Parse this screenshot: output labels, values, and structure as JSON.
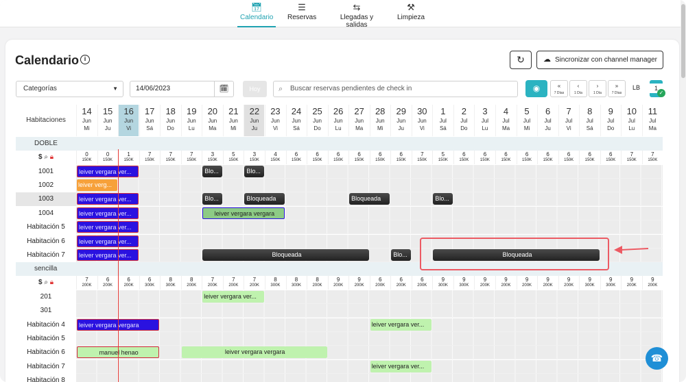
{
  "nav": [
    {
      "label": "Calendario",
      "icon": "calendar-icon",
      "active": true
    },
    {
      "label": "Reservas",
      "icon": "list-icon",
      "active": false
    },
    {
      "label": "Llegadas y salidas",
      "icon": "arrows-icon",
      "active": false
    },
    {
      "label": "Limpieza",
      "icon": "broom-icon",
      "active": false
    }
  ],
  "page": {
    "title": "Calendario",
    "sync_label": "Sincronizar con channel manager"
  },
  "filters": {
    "category_value": "Categorías",
    "date_value": "14/06/2023",
    "today_label": "Hoy",
    "search_placeholder": "Buscar reservas pendientes de check in",
    "nav_buttons": [
      {
        "sym": "«",
        "sub": "7 Días"
      },
      {
        "sym": "‹",
        "sub": "1 Día"
      },
      {
        "sym": "›",
        "sub": "1 Día"
      },
      {
        "sym": "»",
        "sub": "7 Días"
      }
    ],
    "lb_label": "LB",
    "count": "1"
  },
  "colors": {
    "accent": "#2bb3c1",
    "today": "#b4d6e0",
    "reservation": "#2a12e0",
    "blocked": "#333333",
    "checkin_green": "#bff2ae",
    "highlight": "#ec5a63"
  },
  "calendar": {
    "header_label": "Habitaciones",
    "days": [
      {
        "d": "14",
        "m": "Jun",
        "w": "Mi",
        "mark": ""
      },
      {
        "d": "15",
        "m": "Jun",
        "w": "Ju",
        "mark": ""
      },
      {
        "d": "16",
        "m": "Jun",
        "w": "Vi",
        "mark": "today"
      },
      {
        "d": "17",
        "m": "Jun",
        "w": "Sá",
        "mark": ""
      },
      {
        "d": "18",
        "m": "Jun",
        "w": "Do",
        "mark": ""
      },
      {
        "d": "19",
        "m": "Jun",
        "w": "Lu",
        "mark": ""
      },
      {
        "d": "20",
        "m": "Jun",
        "w": "Ma",
        "mark": ""
      },
      {
        "d": "21",
        "m": "Jun",
        "w": "Mi",
        "mark": ""
      },
      {
        "d": "22",
        "m": "Jun",
        "w": "Ju",
        "mark": "grey"
      },
      {
        "d": "23",
        "m": "Jun",
        "w": "Vi",
        "mark": ""
      },
      {
        "d": "24",
        "m": "Jun",
        "w": "Sá",
        "mark": ""
      },
      {
        "d": "25",
        "m": "Jun",
        "w": "Do",
        "mark": ""
      },
      {
        "d": "26",
        "m": "Jun",
        "w": "Lu",
        "mark": ""
      },
      {
        "d": "27",
        "m": "Jun",
        "w": "Ma",
        "mark": ""
      },
      {
        "d": "28",
        "m": "Jun",
        "w": "Mi",
        "mark": ""
      },
      {
        "d": "29",
        "m": "Jun",
        "w": "Ju",
        "mark": ""
      },
      {
        "d": "30",
        "m": "Jun",
        "w": "Vi",
        "mark": ""
      },
      {
        "d": "1",
        "m": "Jul",
        "w": "Sá",
        "mark": ""
      },
      {
        "d": "2",
        "m": "Jul",
        "w": "Do",
        "mark": ""
      },
      {
        "d": "3",
        "m": "Jul",
        "w": "Lu",
        "mark": ""
      },
      {
        "d": "4",
        "m": "Jul",
        "w": "Ma",
        "mark": ""
      },
      {
        "d": "5",
        "m": "Jul",
        "w": "Mi",
        "mark": ""
      },
      {
        "d": "6",
        "m": "Jul",
        "w": "Ju",
        "mark": ""
      },
      {
        "d": "7",
        "m": "Jul",
        "w": "Vi",
        "mark": ""
      },
      {
        "d": "8",
        "m": "Jul",
        "w": "Sá",
        "mark": ""
      },
      {
        "d": "9",
        "m": "Jul",
        "w": "Do",
        "mark": ""
      },
      {
        "d": "10",
        "m": "Jul",
        "w": "Lu",
        "mark": ""
      },
      {
        "d": "11",
        "m": "Jul",
        "w": "Ma",
        "mark": ""
      }
    ],
    "groups": [
      {
        "name": "DOBLE",
        "avail": [
          "0",
          "0",
          "1",
          "7",
          "7",
          "7",
          "3",
          "5",
          "3",
          "4",
          "6",
          "6",
          "6",
          "6",
          "6",
          "6",
          "7",
          "5",
          "6",
          "6",
          "6",
          "6",
          "6",
          "6",
          "6",
          "6",
          "7",
          "7"
        ],
        "prices": [
          "150K",
          "150K",
          "150K",
          "150K",
          "150K",
          "150K",
          "150K",
          "150K",
          "150K",
          "150K",
          "150K",
          "150K",
          "150K",
          "150K",
          "150K",
          "150K",
          "150K",
          "150K",
          "150K",
          "150K",
          "150K",
          "150K",
          "150K",
          "150K",
          "150K",
          "150K",
          "150K",
          "150K"
        ],
        "rooms": [
          {
            "name": "1001",
            "selected": false,
            "bars": [
              {
                "label": "leiver vergara ver...",
                "style": "blue",
                "start": 0,
                "span": 3
              },
              {
                "label": "Blo...",
                "style": "block",
                "start": 6,
                "span": 1
              },
              {
                "label": "Blo...",
                "style": "block",
                "start": 8,
                "span": 1
              }
            ]
          },
          {
            "name": "1002",
            "selected": false,
            "bars": [
              {
                "label": "leiver verg...",
                "style": "orange",
                "start": 0,
                "span": 2
              }
            ]
          },
          {
            "name": "1003",
            "selected": true,
            "bars": [
              {
                "label": "leiver vergara ver...",
                "style": "blue",
                "start": 0,
                "span": 3
              },
              {
                "label": "Blo...",
                "style": "block",
                "start": 6,
                "span": 1
              },
              {
                "label": "Bloqueada",
                "style": "block",
                "start": 8,
                "span": 2
              },
              {
                "label": "Bloqueada",
                "style": "block",
                "start": 13,
                "span": 2
              },
              {
                "label": "Blo...",
                "style": "block",
                "start": 17,
                "span": 1
              }
            ]
          },
          {
            "name": "1004",
            "selected": false,
            "bars": [
              {
                "label": "leiver vergara ver...",
                "style": "blue",
                "start": 0,
                "span": 3
              },
              {
                "label": "leiver vergara vergara",
                "style": "green",
                "start": 6,
                "span": 4
              }
            ]
          },
          {
            "name": "Habitación 5",
            "selected": false,
            "bars": [
              {
                "label": "leiver vergara ver...",
                "style": "blue",
                "start": 0,
                "span": 3
              }
            ]
          },
          {
            "name": "Habitación 6",
            "selected": false,
            "bars": [
              {
                "label": "leiver vergara ver...",
                "style": "blue",
                "start": 0,
                "span": 3
              }
            ]
          },
          {
            "name": "Habitación 7",
            "selected": false,
            "bars": [
              {
                "label": "leiver vergara ver...",
                "style": "blue",
                "start": 0,
                "span": 3
              },
              {
                "label": "Bloqueada",
                "style": "block c",
                "start": 6,
                "span": 8
              },
              {
                "label": "Blo...",
                "style": "block",
                "start": 15,
                "span": 1
              },
              {
                "label": "Bloqueada",
                "style": "block c",
                "start": 17,
                "span": 8
              }
            ]
          }
        ]
      },
      {
        "name": "sencilla",
        "avail": [
          "7",
          "6",
          "6",
          "6",
          "8",
          "8",
          "7",
          "7",
          "7",
          "8",
          "8",
          "8",
          "9",
          "9",
          "6",
          "6",
          "6",
          "9",
          "9",
          "9",
          "9",
          "9",
          "9",
          "9",
          "9",
          "9",
          "9",
          "9"
        ],
        "prices": [
          "200K",
          "200K",
          "200K",
          "300K",
          "300K",
          "200K",
          "200K",
          "200K",
          "200K",
          "300K",
          "300K",
          "200K",
          "200K",
          "200K",
          "200K",
          "200K",
          "200K",
          "300K",
          "300K",
          "200K",
          "200K",
          "200K",
          "200K",
          "200K",
          "300K",
          "300K",
          "200K",
          "200K"
        ],
        "rooms": [
          {
            "name": "201",
            "selected": false,
            "bars": [
              {
                "label": "leiver vergara ver...",
                "style": "lgreen",
                "start": 6,
                "span": 3
              }
            ]
          },
          {
            "name": "301",
            "selected": false,
            "bars": []
          },
          {
            "name": "Habitación 4",
            "selected": false,
            "bars": [
              {
                "label": "leiver vergara vergara",
                "style": "blue",
                "start": 0,
                "span": 4
              },
              {
                "label": "leiver vergara ver...",
                "style": "lgreen",
                "start": 14,
                "span": 3
              }
            ]
          },
          {
            "name": "Habitación 5",
            "selected": false,
            "bars": []
          },
          {
            "name": "Habitación 6",
            "selected": false,
            "bars": [
              {
                "label": "manuel henao",
                "style": "lgreen c red",
                "start": 0,
                "span": 4
              },
              {
                "label": "leiver vergara vergara",
                "style": "lgreen c",
                "start": 5,
                "span": 7
              }
            ]
          },
          {
            "name": "Habitación 7",
            "selected": false,
            "bars": [
              {
                "label": "leiver vergara ver...",
                "style": "lgreen",
                "start": 14,
                "span": 3
              }
            ]
          },
          {
            "name": "Habitación 8",
            "selected": false,
            "bars": []
          }
        ]
      }
    ]
  }
}
